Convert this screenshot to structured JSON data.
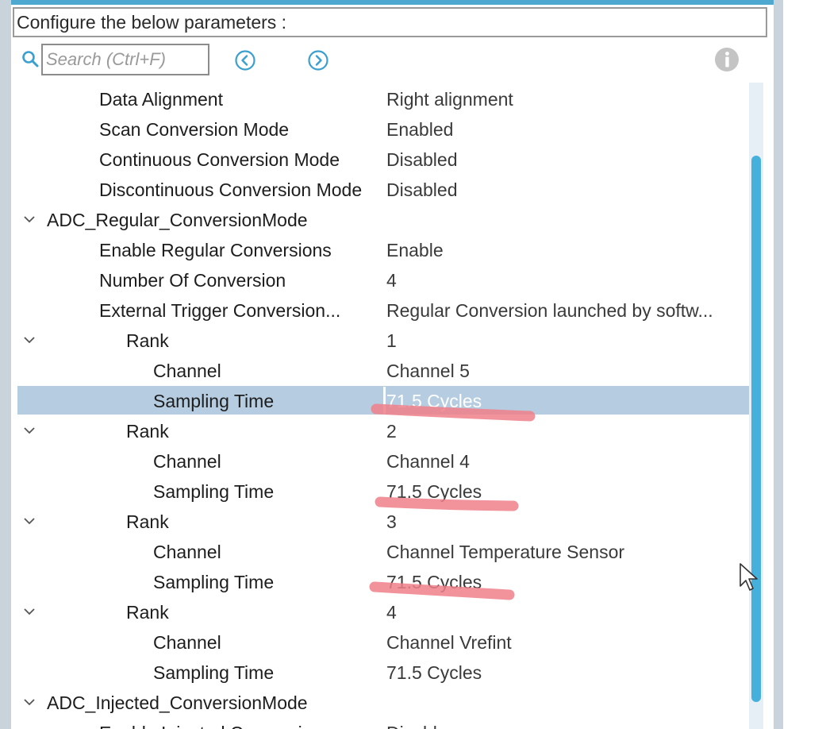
{
  "header": {
    "title": "Configure the below parameters :"
  },
  "search": {
    "placeholder": "Search (Ctrl+F)"
  },
  "icons": {
    "search": "search-icon",
    "previous": "chevron-left-circle-icon",
    "next": "chevron-right-circle-icon",
    "info": "info-icon",
    "expand": "chevron-down-icon",
    "cursor": "mouse-pointer-icon"
  },
  "colors": {
    "accent": "#4fa8cf",
    "selection": "#b6cde1",
    "scrollbar": "#45b0dc",
    "highlight_marks": "#f0808a"
  },
  "params": {
    "data_alignment": {
      "label": "Data Alignment",
      "value": "Right alignment"
    },
    "scan_conversion_mode": {
      "label": "Scan Conversion Mode",
      "value": "Enabled"
    },
    "continuous_conversion_mode": {
      "label": "Continuous Conversion Mode",
      "value": "Disabled"
    },
    "discontinuous_conversion_mode": {
      "label": "Discontinuous Conversion Mode",
      "value": "Disabled"
    },
    "regular_group": {
      "label": "ADC_Regular_ConversionMode"
    },
    "enable_regular_conversions": {
      "label": "Enable Regular Conversions",
      "value": "Enable"
    },
    "number_of_conversion": {
      "label": "Number Of Conversion",
      "value": "4"
    },
    "external_trigger_conversion": {
      "label": "External Trigger Conversion...",
      "value": "Regular Conversion launched by softw..."
    },
    "ranks": [
      {
        "label": "Rank",
        "value": "1",
        "channel_label": "Channel",
        "channel": "Channel 5",
        "sampling_label": "Sampling Time",
        "sampling": "71.5 Cycles"
      },
      {
        "label": "Rank",
        "value": "2",
        "channel_label": "Channel",
        "channel": "Channel 4",
        "sampling_label": "Sampling Time",
        "sampling": "71.5 Cycles"
      },
      {
        "label": "Rank",
        "value": "3",
        "channel_label": "Channel",
        "channel": "Channel Temperature Sensor",
        "sampling_label": "Sampling Time",
        "sampling": "71.5 Cycles"
      },
      {
        "label": "Rank",
        "value": "4",
        "channel_label": "Channel",
        "channel": "Channel Vrefint",
        "sampling_label": "Sampling Time",
        "sampling": "71.5 Cycles"
      }
    ],
    "injected_group": {
      "label": "ADC_Injected_ConversionMode"
    },
    "enable_injected_conversions": {
      "label": "Enable Injected Conversions",
      "value": "Disable"
    }
  }
}
